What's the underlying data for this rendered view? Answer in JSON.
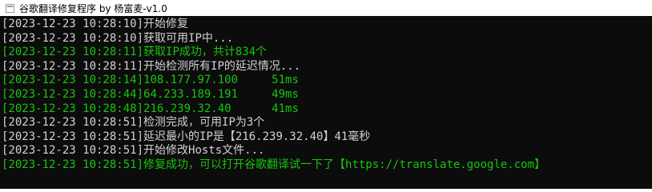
{
  "window": {
    "title": "谷歌翻译修复程序 by 杨富麦-v1.0",
    "icon": "console-window-icon"
  },
  "colors": {
    "background": "#0c0c0c",
    "default_text": "#d2d2d2",
    "success_text": "#16c60c"
  },
  "console": {
    "lines": [
      {
        "timestamp": "[2023-12-23 10:28:10]",
        "message": "开始修复",
        "color": "white"
      },
      {
        "timestamp": "[2023-12-23 10:28:10]",
        "message": "获取可用IP中...",
        "color": "white"
      },
      {
        "timestamp": "[2023-12-23 10:28:11]",
        "message": "获取IP成功，共计834个",
        "color": "green"
      },
      {
        "timestamp": "[2023-12-23 10:28:11]",
        "message": "开始检测所有IP的延迟情况...",
        "color": "white"
      },
      {
        "timestamp": "[2023-12-23 10:28:14]",
        "message": "108.177.97.100     51ms",
        "color": "green"
      },
      {
        "timestamp": "[2023-12-23 10:28:44]",
        "message": "64.233.189.191     49ms",
        "color": "green"
      },
      {
        "timestamp": "[2023-12-23 10:28:48]",
        "message": "216.239.32.40      41ms",
        "color": "green"
      },
      {
        "timestamp": "[2023-12-23 10:28:51]",
        "message": "检测完成，可用IP为3个",
        "color": "white"
      },
      {
        "timestamp": "[2023-12-23 10:28:51]",
        "message": "延迟最小的IP是【216.239.32.40】41毫秒",
        "color": "white"
      },
      {
        "timestamp": "[2023-12-23 10:28:51]",
        "message": "开始修改Hosts文件...",
        "color": "white"
      },
      {
        "timestamp": "[2023-12-23 10:28:51]",
        "message": "修复成功，可以打开谷歌翻译试一下了【https://translate.google.com】",
        "color": "green"
      }
    ]
  }
}
